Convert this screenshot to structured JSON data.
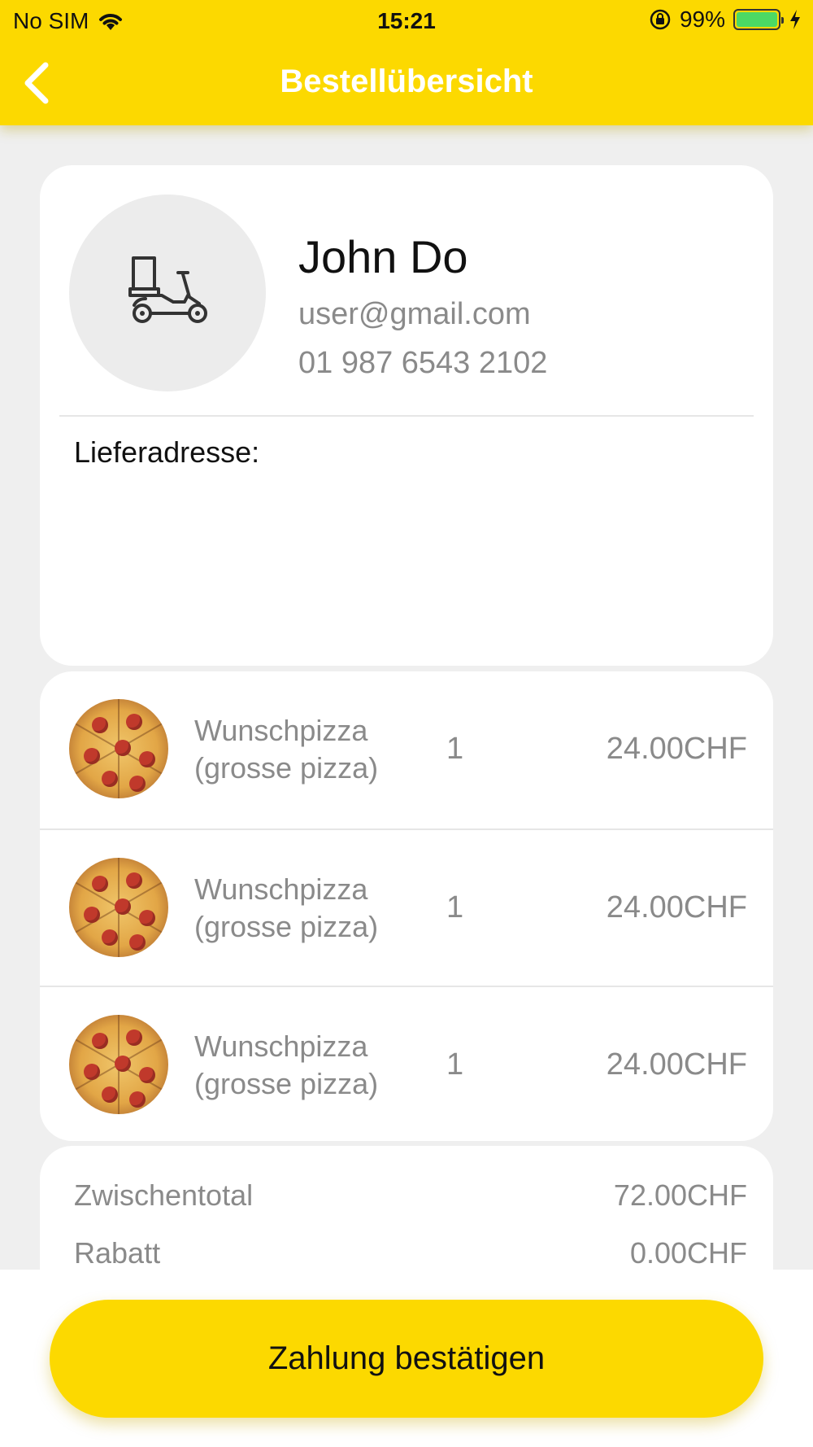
{
  "status_bar": {
    "carrier": "No SIM",
    "time": "15:21",
    "battery": "99%",
    "battery_level": 0.99
  },
  "nav": {
    "title": "Bestellübersicht",
    "back_icon": "chevron-left-icon"
  },
  "user": {
    "avatar_icon": "delivery-scooter-icon",
    "name": "John Do",
    "email": "user@gmail.com",
    "phone": "01 987 6543 2102",
    "address_label": "Lieferadresse:"
  },
  "items": [
    {
      "name_line1": "Wunschpizza",
      "name_line2": "(grosse pizza)",
      "qty": "1",
      "price": "24.00CHF"
    },
    {
      "name_line1": "Wunschpizza",
      "name_line2": "(grosse pizza)",
      "qty": "1",
      "price": "24.00CHF"
    },
    {
      "name_line1": "Wunschpizza",
      "name_line2": "(grosse pizza)",
      "qty": "1",
      "price": "24.00CHF"
    }
  ],
  "totals": {
    "subtotal_label": "Zwischentotal",
    "subtotal_value": "72.00CHF",
    "discount_label": "Rabatt",
    "discount_value": "0.00CHF"
  },
  "footer": {
    "pay_button": "Zahlung bestätigen"
  },
  "colors": {
    "accent": "#fcd900",
    "background": "#efefef",
    "muted_text": "#8a8a8a"
  }
}
